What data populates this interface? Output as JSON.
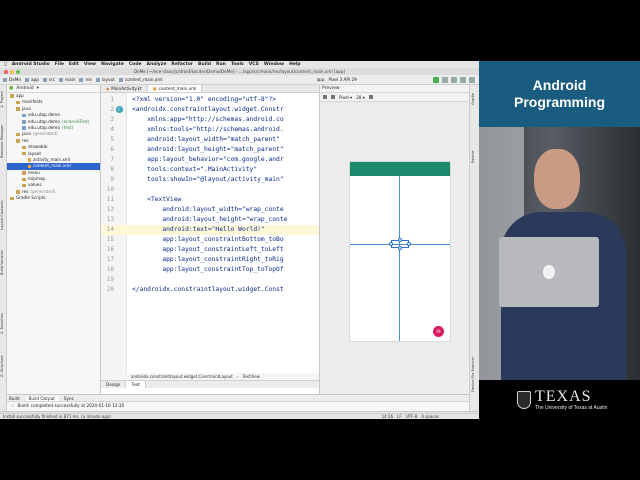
{
  "menubar": {
    "app": "Android Studio",
    "items": [
      "File",
      "Edit",
      "View",
      "Navigate",
      "Code",
      "Analyze",
      "Refactor",
      "Build",
      "Run",
      "Tools",
      "VCS",
      "Window",
      "Help"
    ]
  },
  "titlebar": {
    "title": "DeMe [~/ece-class/jc/droid/kocder/Demo/DeMe] - .../app/src/main/res/layout/content_main.xml [app]"
  },
  "toolbar": {
    "crumbs": [
      "DeMe",
      "app",
      "src",
      "main",
      "res",
      "layout",
      "content_main.xml"
    ],
    "run_config": "app",
    "device": "Pixel 3 API 29"
  },
  "left_tools": [
    "1: Project",
    "Resource Manager",
    "Layout Captures",
    "Build Variants",
    "2: Favorites",
    "Z: Structure"
  ],
  "project": {
    "view": "Android",
    "tree": [
      {
        "indent": 0,
        "label": "app",
        "kind": "folder"
      },
      {
        "indent": 1,
        "label": "manifests",
        "kind": "folder"
      },
      {
        "indent": 1,
        "label": "java",
        "kind": "folder"
      },
      {
        "indent": 2,
        "label": "edu.utap.demo",
        "kind": "blue"
      },
      {
        "indent": 2,
        "label": "edu.utap.demo",
        "suffix": "(androidTest)",
        "kind": "blue"
      },
      {
        "indent": 2,
        "label": "edu.utap.demo",
        "suffix": "(test)",
        "kind": "blue"
      },
      {
        "indent": 1,
        "label": "java",
        "suffix": "(generated)",
        "kind": "folder"
      },
      {
        "indent": 1,
        "label": "res",
        "kind": "folder"
      },
      {
        "indent": 2,
        "label": "drawable",
        "kind": "folder"
      },
      {
        "indent": 2,
        "label": "layout",
        "kind": "folder"
      },
      {
        "indent": 3,
        "label": "activity_main.xml",
        "kind": "file"
      },
      {
        "indent": 3,
        "label": "content_main.xml",
        "kind": "file",
        "selected": true
      },
      {
        "indent": 2,
        "label": "menu",
        "kind": "folder"
      },
      {
        "indent": 2,
        "label": "mipmap",
        "kind": "folder"
      },
      {
        "indent": 2,
        "label": "values",
        "kind": "folder"
      },
      {
        "indent": 1,
        "label": "res",
        "suffix": "(generated)",
        "kind": "folder"
      },
      {
        "indent": 0,
        "label": "Gradle Scripts",
        "kind": "folder"
      }
    ]
  },
  "editor": {
    "tabs": [
      "MainActivity.kt",
      "content_main.xml"
    ],
    "lines": [
      {
        "n": "1",
        "text": "<?xml version=\"1.0\" encoding=\"utf-8\"?>"
      },
      {
        "n": "2",
        "text": "<androidx.constraintlayout.widget.Constr"
      },
      {
        "n": "3",
        "text": "    xmlns:app=\"http://schemas.android.co"
      },
      {
        "n": "4",
        "text": "    xmlns:tools=\"http://schemas.android."
      },
      {
        "n": "5",
        "text": "    android:layout_width=\"match_parent\""
      },
      {
        "n": "6",
        "text": "    android:layout_height=\"match_parent\""
      },
      {
        "n": "7",
        "text": "    app:layout_behavior=\"com.google.andr"
      },
      {
        "n": "8",
        "text": "    tools:context=\".MainActivity\""
      },
      {
        "n": "9",
        "text": "    tools:showIn=\"@layout/activity_main\""
      },
      {
        "n": "10",
        "text": ""
      },
      {
        "n": "11",
        "text": "    <TextView"
      },
      {
        "n": "12",
        "text": "        android:layout_width=\"wrap_conte"
      },
      {
        "n": "13",
        "text": "        android:layout_height=\"wrap_conte"
      },
      {
        "n": "14",
        "text": "        android:text=\"Hello World!\"",
        "highlight": true
      },
      {
        "n": "15",
        "text": "        app:layout_constraintBottom_toBo"
      },
      {
        "n": "16",
        "text": "        app:layout_constraintLeft_toLeft"
      },
      {
        "n": "17",
        "text": "        app:layout_constraintRight_toRig"
      },
      {
        "n": "18",
        "text": "        app:layout_constraintTop_toTopOf"
      },
      {
        "n": "19",
        "text": ""
      },
      {
        "n": "20",
        "text": "</androidx.constraintlayout.widget.Const"
      }
    ],
    "breadcrumb": [
      "androidx.constraintlayout.widget.ConstraintLayout",
      "TextView"
    ],
    "bottom_tabs": [
      "Design",
      "Text"
    ]
  },
  "preview": {
    "title": "Preview",
    "device": "Pixel",
    "api": "28",
    "colors": {
      "appbar": "#1d8a6e",
      "fab": "#d81b60",
      "constraint": "#4b8fd6"
    }
  },
  "right_tools": [
    "Gradle",
    "Palette",
    "Device File Explorer"
  ],
  "build": {
    "tabs": [
      "Build",
      "Build Output",
      "Sync"
    ],
    "message": "Build: completed successfully at 2020-01-16 12:35"
  },
  "toolwindows": [
    "TODO",
    "Terminal",
    "Build",
    "6: Logcat",
    "Profiler",
    "4: Run"
  ],
  "statusbar": {
    "left": "Install successfully finished in 871 ms. (a minute ago)",
    "position": "14:26",
    "encoding": "LF",
    "charset": "UTF-8",
    "spaces": "4 spaces",
    "event_log": "Event Log"
  },
  "brand": {
    "line1": "Android",
    "line2": "Programming"
  },
  "logo": {
    "word": "TEXAS",
    "subtitle": "The University of Texas at Austin"
  }
}
